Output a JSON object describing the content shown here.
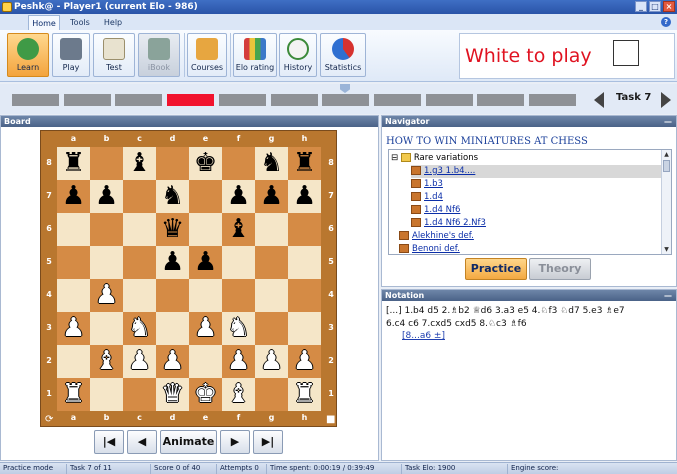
{
  "window": {
    "title": "Peshk@ - Player1 (current Elo - 986)"
  },
  "menu": {
    "tabs": [
      {
        "label": "Home",
        "active": true
      },
      {
        "label": "Tools",
        "active": false
      },
      {
        "label": "Help",
        "active": false
      }
    ]
  },
  "toolbar": {
    "buttons": [
      {
        "label": "Learn",
        "icon": "learn-icon",
        "state": "active"
      },
      {
        "label": "Play",
        "icon": "play-robot-icon",
        "state": "normal"
      },
      {
        "label": "Test",
        "icon": "test-pencil-icon",
        "state": "normal"
      },
      {
        "label": "iBook",
        "icon": "ibook-icon",
        "state": "disabled"
      },
      {
        "label": "Courses",
        "icon": "books-icon",
        "state": "normal"
      },
      {
        "label": "Elo rating",
        "icon": "bar-chart-icon",
        "state": "normal"
      },
      {
        "label": "History",
        "icon": "clock-icon",
        "state": "normal"
      },
      {
        "label": "Statistics",
        "icon": "pie-chart-icon",
        "state": "normal"
      }
    ]
  },
  "status_header": {
    "to_move": "White to play",
    "side_color": "#ffffff"
  },
  "task_progress": {
    "segments": 11,
    "current_segment_index": 3,
    "task_label": "Task 7"
  },
  "board_panel": {
    "title": "Board",
    "files": [
      "a",
      "b",
      "c",
      "d",
      "e",
      "f",
      "g",
      "h"
    ],
    "ranks": [
      "8",
      "7",
      "6",
      "5",
      "4",
      "3",
      "2",
      "1"
    ],
    "position": [
      [
        "r",
        "",
        "b",
        "",
        "k",
        "",
        "n",
        "r"
      ],
      [
        "p",
        "p",
        "",
        "n",
        "",
        "p",
        "p",
        "p"
      ],
      [
        "",
        "",
        "",
        "q",
        "",
        "b",
        "",
        ""
      ],
      [
        "",
        "",
        "",
        "p",
        "p",
        "",
        "",
        ""
      ],
      [
        "",
        "P",
        "",
        "",
        "",
        "",
        "",
        ""
      ],
      [
        "P",
        "",
        "N",
        "",
        "P",
        "N",
        "",
        ""
      ],
      [
        "",
        "B",
        "P",
        "P",
        "",
        "P",
        "P",
        "P"
      ],
      [
        "R",
        "",
        "",
        "Q",
        "K",
        "B",
        "",
        "R"
      ]
    ],
    "controls": {
      "first": "|◀",
      "prev": "◀",
      "animate": "Animate",
      "next": "▶",
      "last": "▶|"
    }
  },
  "navigator": {
    "title": "Navigator",
    "heading": "HOW TO WIN MINIATURES AT CHESS",
    "tree": [
      {
        "label": "Rare variations",
        "kind": "folder",
        "indent": 0,
        "selected": false
      },
      {
        "label": "1.g3 1.b4....",
        "kind": "item",
        "indent": 1,
        "selected": true
      },
      {
        "label": "1.b3",
        "kind": "item",
        "indent": 1,
        "selected": false
      },
      {
        "label": "1.d4",
        "kind": "item",
        "indent": 1,
        "selected": false
      },
      {
        "label": "1.d4 Nf6",
        "kind": "item",
        "indent": 1,
        "selected": false
      },
      {
        "label": "1.d4 Nf6 2.Nf3",
        "kind": "item",
        "indent": 1,
        "selected": false
      },
      {
        "label": "Alekhine's def.",
        "kind": "item",
        "indent": 0,
        "selected": false
      },
      {
        "label": "Benoni def.",
        "kind": "item",
        "indent": 0,
        "selected": false
      }
    ],
    "practice_label": "Practice",
    "theory_label": "Theory"
  },
  "notation_panel": {
    "title": "Notation",
    "line1": "[...] 1.b4 d5 2.♗b2 ♕d6 3.a3 e5 4.♘f3 ♘d7 5.e3 ♗e7",
    "line2": "6.c4 c6 7.cxd5 cxd5 8.♘c3 ♗f6",
    "variation": "[8...a6 ±]"
  },
  "statusbar": {
    "mode": "Practice mode",
    "task": "Task 7 of 11",
    "score": "Score 0 of 40",
    "attempts": "Attempts 0",
    "time_spent": "Time spent: 0:00:19 / 0:39:49",
    "task_elo": "Task Elo: 1900",
    "engine": "Engine score:"
  },
  "colors": {
    "accent_red": "#e01321",
    "progress_current": "#f1132e",
    "board_light": "#f5e6c8",
    "board_dark": "#d58b45"
  }
}
